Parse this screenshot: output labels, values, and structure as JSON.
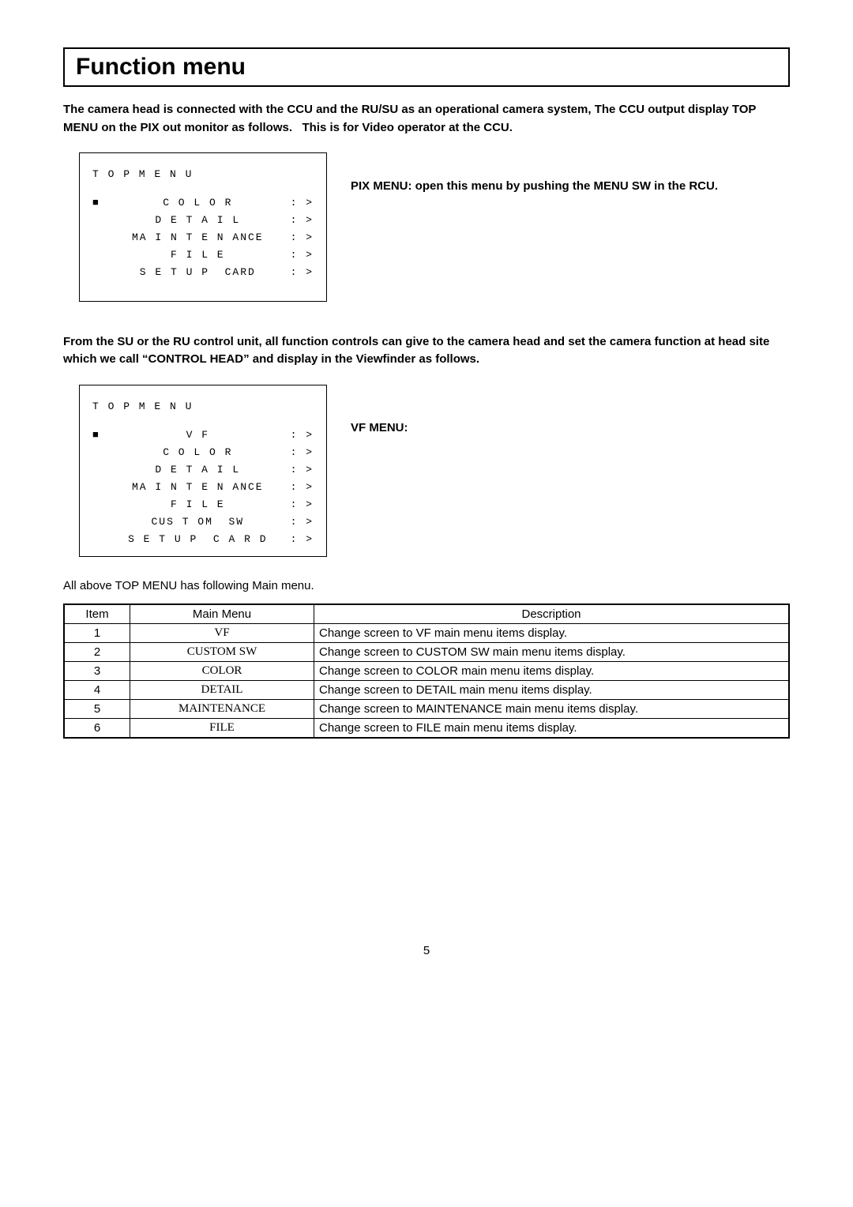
{
  "title": "Function menu",
  "intro": "The camera head is connected with the CCU and the RU/SU as an operational camera system, The CCU output display TOP MENU on the PIX out monitor as follows.   This is for Video operator at the CCU.",
  "pix_menu_box": {
    "title": "T O P   M E N U",
    "items": [
      {
        "bullet": "■",
        "label": "C O L O R",
        "suffix": ": >"
      },
      {
        "bullet": " ",
        "label": "D E T A I L",
        "suffix": ": >"
      },
      {
        "bullet": " ",
        "label": "MA I N T E N ANCE",
        "suffix": ": >"
      },
      {
        "bullet": " ",
        "label": "F I L E",
        "suffix": ": >"
      },
      {
        "bullet": " ",
        "label": "S E T U P  CARD",
        "suffix": ": >"
      }
    ]
  },
  "pix_side_text": "PIX MENU: open this menu by pushing the MENU SW in the RCU.",
  "mid_para": "From the SU or the RU control unit, all function controls can give to the camera head and set the camera function at head site which we call “CONTROL HEAD” and display in the Viewfinder as follows.",
  "vf_menu_box": {
    "title": "T O P   M E N U",
    "items": [
      {
        "bullet": "■",
        "label": "V F",
        "suffix": ": >"
      },
      {
        "bullet": " ",
        "label": "C O L O R",
        "suffix": ": >"
      },
      {
        "bullet": " ",
        "label": "D E T A I L",
        "suffix": ": >"
      },
      {
        "bullet": " ",
        "label": "MA I N T E N ANCE",
        "suffix": ": >"
      },
      {
        "bullet": " ",
        "label": "F I L E",
        "suffix": ": >"
      },
      {
        "bullet": " ",
        "label": "CUS T OM  SW",
        "suffix": ": >"
      },
      {
        "bullet": " ",
        "label": "S E T U P  C A R D",
        "suffix": ": >"
      }
    ]
  },
  "vf_side_text": "VF MENU:",
  "below_text": "All above TOP MENU has following Main menu.",
  "table": {
    "headers": {
      "item": "Item",
      "menu": "Main Menu",
      "desc": "Description"
    },
    "rows": [
      {
        "item": "1",
        "menu": "VF",
        "desc": "Change screen to VF main menu items display."
      },
      {
        "item": "2",
        "menu": "CUSTOM SW",
        "desc": "Change screen to CUSTOM SW main menu items display."
      },
      {
        "item": "3",
        "menu": "COLOR",
        "desc": "Change screen to COLOR main menu items display."
      },
      {
        "item": "4",
        "menu": "DETAIL",
        "desc": "Change screen to DETAIL main menu items display."
      },
      {
        "item": "5",
        "menu": "MAINTENANCE",
        "desc": "Change screen to MAINTENANCE main menu items display."
      },
      {
        "item": "6",
        "menu": "FILE",
        "desc": "Change screen to FILE main menu items display."
      }
    ]
  },
  "page_number": "5"
}
